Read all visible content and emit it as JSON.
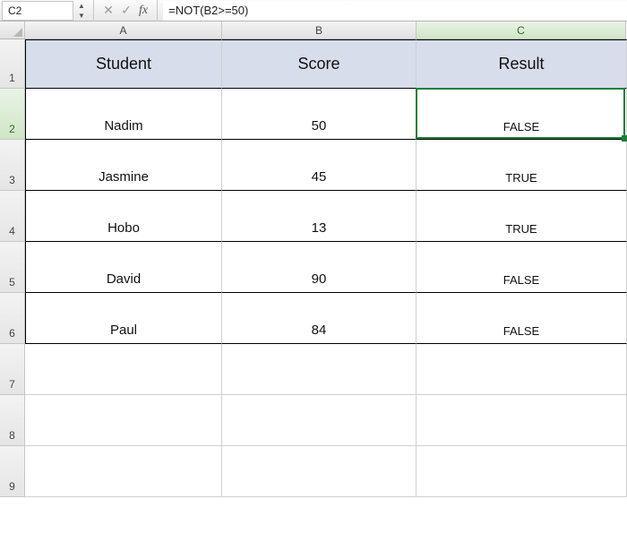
{
  "formula_bar": {
    "cell_ref": "C2",
    "formula": "=NOT(B2>=50)",
    "fx_label": "fx",
    "cancel_label": "✕",
    "confirm_label": "✓"
  },
  "columns": [
    "A",
    "B",
    "C"
  ],
  "row_labels": [
    "1",
    "2",
    "3",
    "4",
    "5",
    "6",
    "7",
    "8",
    "9"
  ],
  "selected_cell": {
    "col": "C",
    "row": "2"
  },
  "headers": {
    "A": "Student",
    "B": "Score",
    "C": "Result"
  },
  "rows": [
    {
      "A": "Nadim",
      "B": "50",
      "C": "FALSE"
    },
    {
      "A": "Jasmine",
      "B": "45",
      "C": "TRUE"
    },
    {
      "A": "Hobo",
      "B": "13",
      "C": "TRUE"
    },
    {
      "A": "David",
      "B": "90",
      "C": "FALSE"
    },
    {
      "A": "Paul",
      "B": "84",
      "C": "FALSE"
    }
  ],
  "chart_data": {
    "type": "table",
    "title": "",
    "columns": [
      "Student",
      "Score",
      "Result"
    ],
    "data": [
      [
        "Nadim",
        50,
        "FALSE"
      ],
      [
        "Jasmine",
        45,
        "TRUE"
      ],
      [
        "Hobo",
        13,
        "TRUE"
      ],
      [
        "David",
        90,
        "FALSE"
      ],
      [
        "Paul",
        84,
        "FALSE"
      ]
    ]
  }
}
